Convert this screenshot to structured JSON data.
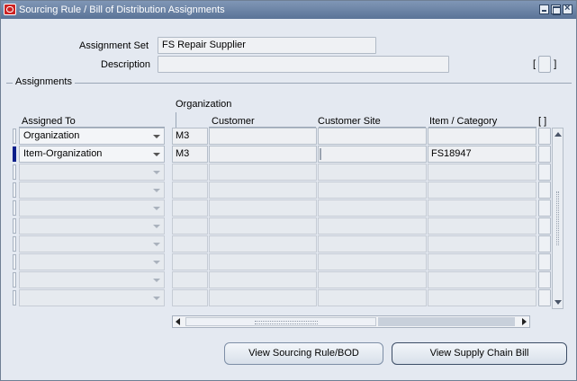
{
  "window": {
    "title": "Sourcing Rule / Bill of Distribution Assignments"
  },
  "header": {
    "assignment_set_label": "Assignment Set",
    "assignment_set_value": "FS Repair Supplier",
    "description_label": "Description",
    "description_value": "",
    "descriptive_flex_label": "[ ]"
  },
  "assignments": {
    "group_title": "Assignments",
    "columns": {
      "org_group": "Organization",
      "assigned_to": "Assigned To",
      "customer": "Customer",
      "customer_site": "Customer Site",
      "item_category": "Item / Category",
      "flex": "[ ]"
    },
    "rows": [
      {
        "assigned_to": "Organization",
        "organization": "M3",
        "customer": "",
        "customer_site": "",
        "item_category": ""
      },
      {
        "assigned_to": "Item-Organization",
        "organization": "M3",
        "customer": "",
        "customer_site": "",
        "item_category": "FS18947"
      },
      {
        "assigned_to": "",
        "organization": "",
        "customer": "",
        "customer_site": "",
        "item_category": ""
      },
      {
        "assigned_to": "",
        "organization": "",
        "customer": "",
        "customer_site": "",
        "item_category": ""
      },
      {
        "assigned_to": "",
        "organization": "",
        "customer": "",
        "customer_site": "",
        "item_category": ""
      },
      {
        "assigned_to": "",
        "organization": "",
        "customer": "",
        "customer_site": "",
        "item_category": ""
      },
      {
        "assigned_to": "",
        "organization": "",
        "customer": "",
        "customer_site": "",
        "item_category": ""
      },
      {
        "assigned_to": "",
        "organization": "",
        "customer": "",
        "customer_site": "",
        "item_category": ""
      },
      {
        "assigned_to": "",
        "organization": "",
        "customer": "",
        "customer_site": "",
        "item_category": ""
      },
      {
        "assigned_to": "",
        "organization": "",
        "customer": "",
        "customer_site": "",
        "item_category": ""
      }
    ]
  },
  "buttons": {
    "view_sourcing_rule": "View Sourcing Rule/BOD",
    "view_supply_chain_bill": "View Supply Chain Bill"
  },
  "colors": {
    "titlebar": "#5a7397",
    "current_record_indicator": "#0c1f8a",
    "window_background": "#e4e9f1"
  }
}
